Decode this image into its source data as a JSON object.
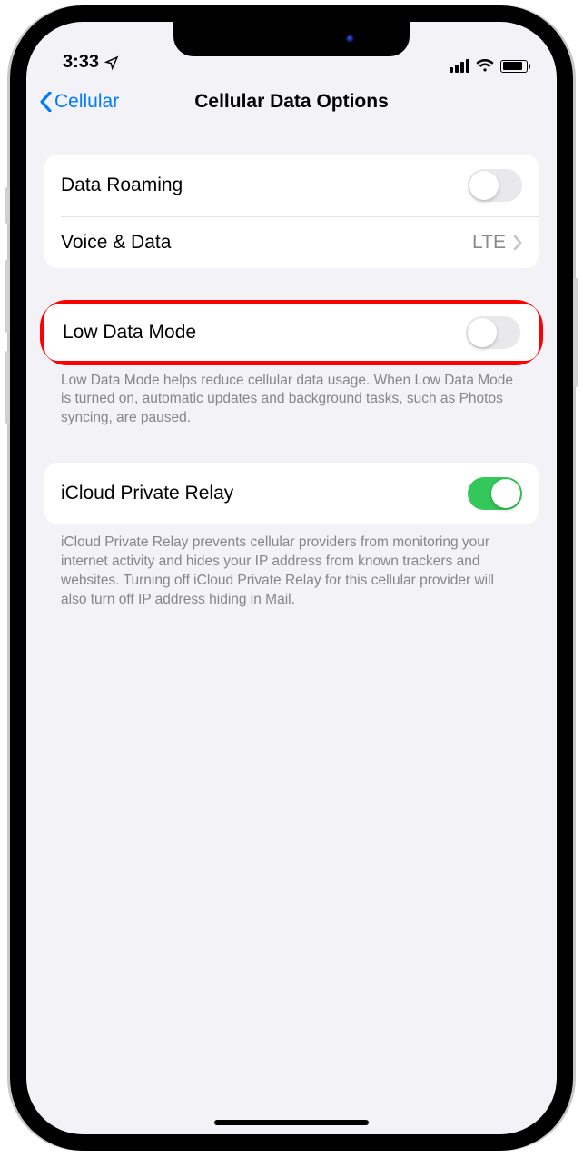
{
  "status": {
    "time": "3:33"
  },
  "nav": {
    "back_label": "Cellular",
    "title": "Cellular Data Options"
  },
  "rows": {
    "data_roaming": {
      "label": "Data Roaming",
      "on": false
    },
    "voice_data": {
      "label": "Voice & Data",
      "value": "LTE"
    },
    "low_data": {
      "label": "Low Data Mode",
      "on": false,
      "footer": "Low Data Mode helps reduce cellular data usage. When Low Data Mode is turned on, automatic updates and background tasks, such as Photos syncing, are paused."
    },
    "private_relay": {
      "label": "iCloud Private Relay",
      "on": true,
      "footer": "iCloud Private Relay prevents cellular providers from monitoring your internet activity and hides your IP address from known trackers and websites. Turning off iCloud Private Relay for this cellular provider will also turn off IP address hiding in Mail."
    }
  }
}
